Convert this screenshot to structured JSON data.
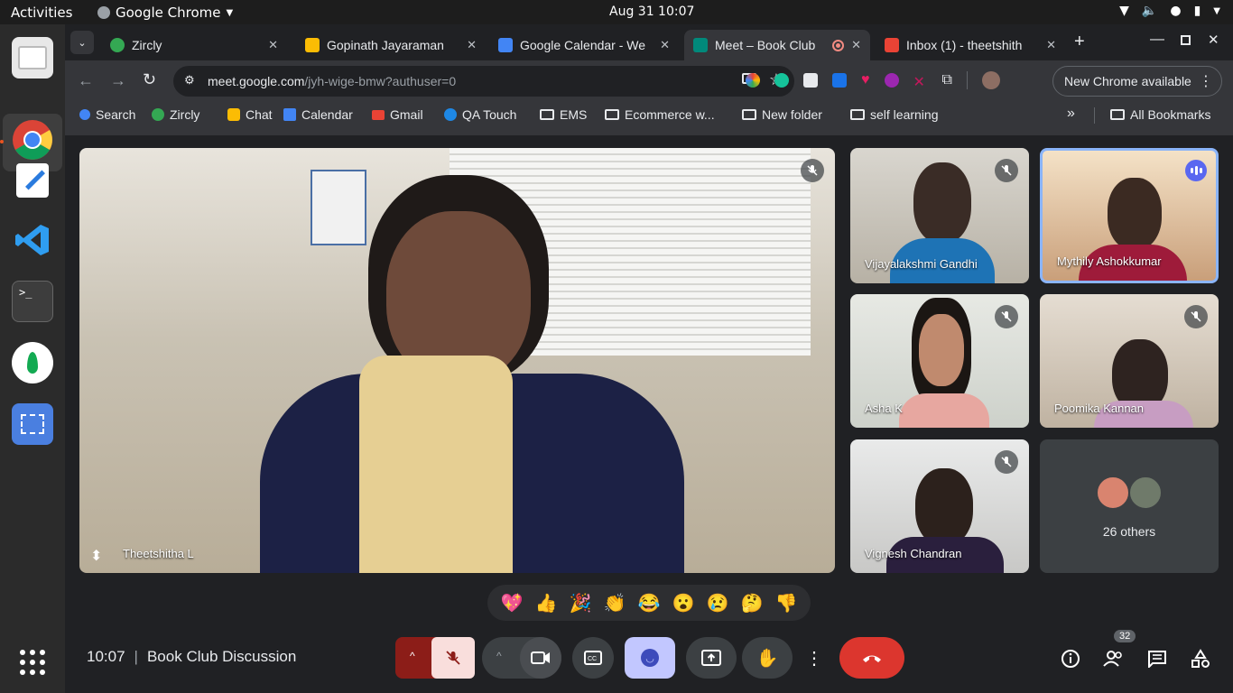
{
  "system": {
    "activities": "Activities",
    "app_name": "Google Chrome",
    "clock": "Aug 31  10:07"
  },
  "dock": {
    "items": [
      "chrome-icon",
      "text-editor-icon",
      "vscode-icon",
      "terminal-icon",
      "mongodb-icon",
      "screenshot-icon"
    ],
    "show_apps": "apps-grid-icon"
  },
  "browser": {
    "tabs": [
      {
        "title": "Zircly",
        "favicon_color": "#34a853"
      },
      {
        "title": "Gopinath Jayaraman",
        "favicon_color": "#fbbc04"
      },
      {
        "title": "Google Calendar - We",
        "favicon_color": "#4285f4"
      },
      {
        "title": "Meet – Book Club",
        "favicon_color": "#00897b",
        "active": true
      },
      {
        "title": "Inbox (1) - theetshith",
        "favicon_color": "#ea4335"
      }
    ],
    "url_host": "meet.google.com",
    "url_path": "/jyh-wige-bmw?authuser=0",
    "new_chrome": "New Chrome available",
    "bookmarks": [
      "Search",
      "Zircly",
      "Chat",
      "Calendar",
      "Gmail",
      "QA Touch",
      "EMS",
      "Ecommerce w...",
      "New folder",
      "self learning"
    ],
    "all_bookmarks": "All Bookmarks"
  },
  "meet": {
    "main_participant": "Theetshitha L",
    "participants": [
      {
        "name": "Vijayalakshmi Gandhi",
        "muted": true
      },
      {
        "name": "Mythily Ashokkumar",
        "muted": false,
        "speaking": true
      },
      {
        "name": "Asha K",
        "muted": true
      },
      {
        "name": "Poomika Kannan",
        "muted": true
      },
      {
        "name": "Vignesh Chandran",
        "muted": true
      }
    ],
    "others": "26 others",
    "reactions": [
      "💖",
      "👍",
      "🎉",
      "👏",
      "😂",
      "😮",
      "😢",
      "🤔",
      "👎"
    ],
    "time": "10:07",
    "meeting_name": "Book Club Discussion",
    "participant_count": "32",
    "accent_red": "#ea4335",
    "accent_purple": "#c2c7ff"
  }
}
